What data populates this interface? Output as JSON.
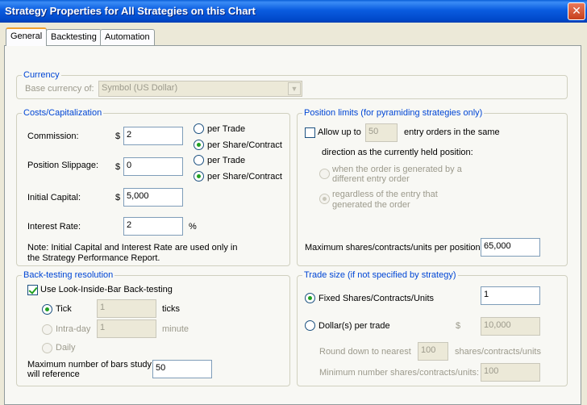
{
  "window": {
    "title": "Strategy Properties for All Strategies on this Chart",
    "close_glyph": "✕"
  },
  "tabs": [
    {
      "label": "General"
    },
    {
      "label": "Backtesting"
    },
    {
      "label": "Automation"
    }
  ],
  "currency": {
    "legend": "Currency",
    "base_label": "Base currency of:",
    "base_value": "Symbol (US Dollar)"
  },
  "costs": {
    "legend": "Costs/Capitalization",
    "commission_label": "Commission:",
    "commission_currency": "$",
    "commission_value": "2",
    "commission_per_trade": "per Trade",
    "commission_per_share": "per Share/Contract",
    "slippage_label": "Position Slippage:",
    "slippage_currency": "$",
    "slippage_value": "0",
    "slippage_per_trade": "per Trade",
    "slippage_per_share": "per Share/Contract",
    "capital_label": "Initial Capital:",
    "capital_currency": "$",
    "capital_value": "5,000",
    "interest_label": "Interest Rate:",
    "interest_value": "2",
    "interest_unit": "%",
    "note_line1": "Note: Initial Capital and Interest Rate are used only in",
    "note_line2": "the Strategy Performance Report."
  },
  "position_limits": {
    "legend": "Position limits (for pyramiding strategies only)",
    "allow_label": "Allow up to",
    "allow_value": "50",
    "entry_text": "entry orders in the same",
    "direction_text": "direction as the currently held position:",
    "option1_line1": "when the order is generated by a",
    "option1_line2": "different entry order",
    "option2_line1": "regardless of the entry that",
    "option2_line2": "generated the order",
    "max_label": "Maximum shares/contracts/units per position",
    "max_value": "65,000"
  },
  "backtesting": {
    "legend": "Back-testing resolution",
    "lib_label": "Use Look-Inside-Bar Back-testing",
    "tick_label": "Tick",
    "tick_value": "1",
    "tick_unit": "ticks",
    "intraday_label": "Intra-day",
    "intraday_value": "1",
    "intraday_unit": "minute",
    "daily_label": "Daily",
    "maxbars_line1": "Maximum number of bars study",
    "maxbars_line2": "will reference",
    "maxbars_value": "50"
  },
  "trade_size": {
    "legend": "Trade size (if not specified by strategy)",
    "fixed_label": "Fixed Shares/Contracts/Units",
    "fixed_value": "1",
    "dollar_label": "Dollar(s) per trade",
    "dollar_currency": "$",
    "dollar_value": "10,000",
    "round_label": "Round down to nearest",
    "round_value": "100",
    "round_unit": "shares/contracts/units",
    "min_label": "Minimum number shares/contracts/units:",
    "min_value": "100"
  }
}
